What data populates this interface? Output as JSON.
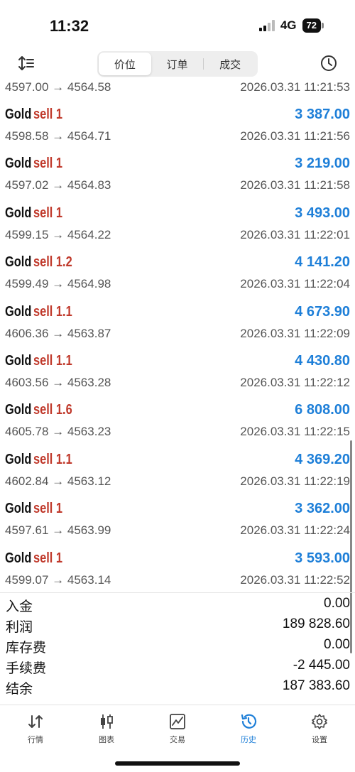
{
  "status_bar": {
    "time": "11:32",
    "network": "4G",
    "battery": "72"
  },
  "toolbar": {
    "tabs": [
      {
        "label": "价位",
        "active": true
      },
      {
        "label": "订单",
        "active": false
      },
      {
        "label": "成交",
        "active": false
      }
    ]
  },
  "partial_row": {
    "prices": "4597.00 → 4564.58",
    "time": "2026.03.31 11:21:53"
  },
  "deals": [
    {
      "symbol": "Gold",
      "type": "sell 1",
      "profit": "3 387.00",
      "prices": "4598.58 → 4564.71",
      "time": "2026.03.31 11:21:56"
    },
    {
      "symbol": "Gold",
      "type": "sell 1",
      "profit": "3 219.00",
      "prices": "4597.02 → 4564.83",
      "time": "2026.03.31 11:21:58"
    },
    {
      "symbol": "Gold",
      "type": "sell 1",
      "profit": "3 493.00",
      "prices": "4599.15 → 4564.22",
      "time": "2026.03.31 11:22:01"
    },
    {
      "symbol": "Gold",
      "type": "sell 1.2",
      "profit": "4 141.20",
      "prices": "4599.49 → 4564.98",
      "time": "2026.03.31 11:22:04"
    },
    {
      "symbol": "Gold",
      "type": "sell 1.1",
      "profit": "4 673.90",
      "prices": "4606.36 → 4563.87",
      "time": "2026.03.31 11:22:09"
    },
    {
      "symbol": "Gold",
      "type": "sell 1.1",
      "profit": "4 430.80",
      "prices": "4603.56 → 4563.28",
      "time": "2026.03.31 11:22:12"
    },
    {
      "symbol": "Gold",
      "type": "sell 1.6",
      "profit": "6 808.00",
      "prices": "4605.78 → 4563.23",
      "time": "2026.03.31 11:22:15"
    },
    {
      "symbol": "Gold",
      "type": "sell 1.1",
      "profit": "4 369.20",
      "prices": "4602.84 → 4563.12",
      "time": "2026.03.31 11:22:19"
    },
    {
      "symbol": "Gold",
      "type": "sell 1",
      "profit": "3 362.00",
      "prices": "4597.61 → 4563.99",
      "time": "2026.03.31 11:22:24"
    },
    {
      "symbol": "Gold",
      "type": "sell 1",
      "profit": "3 593.00",
      "prices": "4599.07 → 4563.14",
      "time": "2026.03.31 11:22:52"
    }
  ],
  "summary": [
    {
      "label": "入金",
      "value": "0.00"
    },
    {
      "label": "利润",
      "value": "189 828.60"
    },
    {
      "label": "库存费",
      "value": "0.00"
    },
    {
      "label": "手续费",
      "value": "-2 445.00"
    },
    {
      "label": "结余",
      "value": "187 383.60"
    }
  ],
  "tabbar": [
    {
      "label": "行情",
      "icon": "quotes-arrows-icon",
      "active": false
    },
    {
      "label": "图表",
      "icon": "candlestick-chart-icon",
      "active": false
    },
    {
      "label": "交易",
      "icon": "trade-chart-icon",
      "active": false
    },
    {
      "label": "历史",
      "icon": "history-clock-icon",
      "active": true
    },
    {
      "label": "设置",
      "icon": "settings-gear-icon",
      "active": false
    }
  ],
  "colors": {
    "profit": "#1e7fd8",
    "sell": "#c0392b",
    "active_tab": "#1e7fd8"
  }
}
